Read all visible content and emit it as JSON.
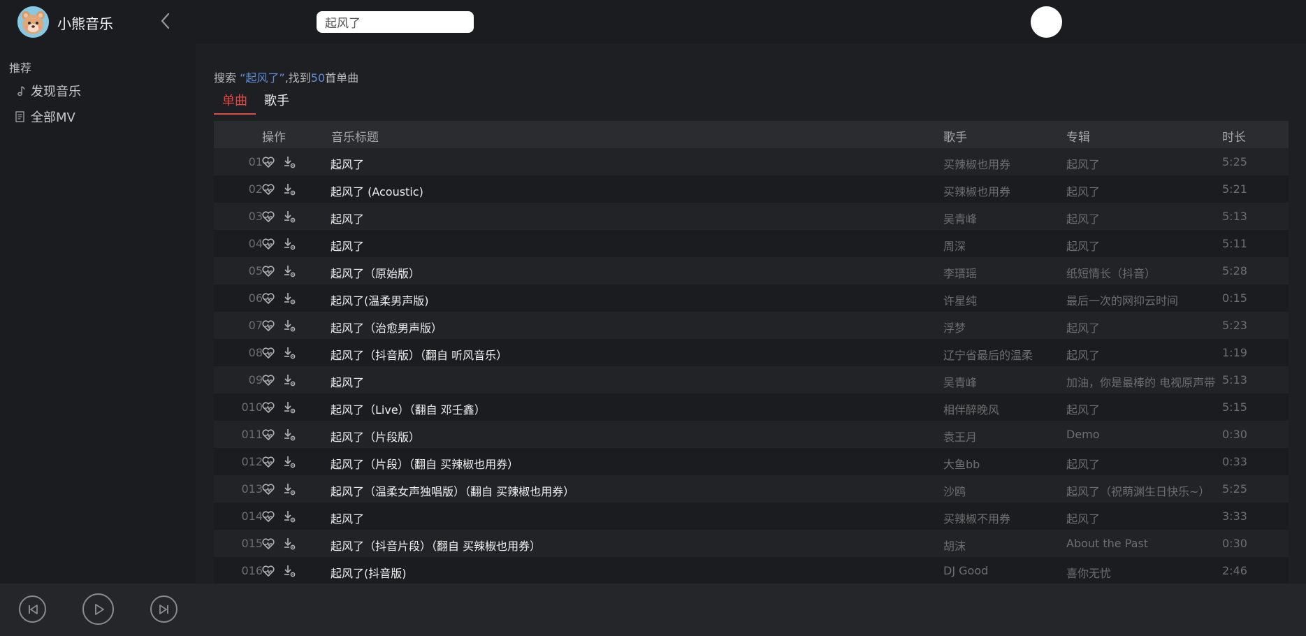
{
  "header": {
    "app_name": "小熊音乐",
    "search_value": "起风了"
  },
  "sidebar": {
    "heading": "推荐",
    "items": [
      {
        "label": "发现音乐",
        "icon": "music-note-icon"
      },
      {
        "label": "全部MV",
        "icon": "document-icon"
      }
    ]
  },
  "search_summary": {
    "prefix": "搜索",
    "query": "“起风了”",
    "middle": ",找到",
    "count": "50",
    "suffix": "首单曲"
  },
  "tabs": [
    {
      "label": "单曲",
      "active": true
    },
    {
      "label": "歌手",
      "active": false
    }
  ],
  "table": {
    "headers": {
      "ops": "操作",
      "title": "音乐标题",
      "artist": "歌手",
      "album": "专辑",
      "duration": "时长"
    },
    "rows": [
      {
        "idx": "01",
        "title": "起风了",
        "artist": "买辣椒也用券",
        "album": "起风了",
        "duration": "5:25"
      },
      {
        "idx": "02",
        "title": "起风了 (Acoustic)",
        "artist": "买辣椒也用券",
        "album": "起风了",
        "duration": "5:21"
      },
      {
        "idx": "03",
        "title": "起风了",
        "artist": "吴青峰",
        "album": "起风了",
        "duration": "5:13"
      },
      {
        "idx": "04",
        "title": "起风了",
        "artist": "周深",
        "album": "起风了",
        "duration": "5:11"
      },
      {
        "idx": "05",
        "title": "起风了（原始版）",
        "artist": "李瑨瑶",
        "album": "纸短情长（抖音）",
        "duration": "5:28"
      },
      {
        "idx": "06",
        "title": "起风了(温柔男声版)",
        "artist": "许星纯",
        "album": "最后一次的网抑云时间",
        "duration": "0:15"
      },
      {
        "idx": "07",
        "title": "起风了（治愈男声版）",
        "artist": "浮梦",
        "album": "起风了",
        "duration": "5:23"
      },
      {
        "idx": "08",
        "title": "起风了（抖音版）（翻自 听风音乐）",
        "artist": "辽宁省最后的温柔",
        "album": "起风了",
        "duration": "1:19"
      },
      {
        "idx": "09",
        "title": "起风了",
        "artist": "吴青峰",
        "album": "加油，你是最棒的 电视原声带",
        "duration": "5:13"
      },
      {
        "idx": "010",
        "title": "起风了（Live）（翻自 邓壬鑫）",
        "artist": "相伴醉晚风",
        "album": "起风了",
        "duration": "5:15"
      },
      {
        "idx": "011",
        "title": "起风了（片段版）",
        "artist": "袁王月",
        "album": "Demo",
        "duration": "0:30"
      },
      {
        "idx": "012",
        "title": "起风了（片段）（翻自 买辣椒也用券）",
        "artist": "大鱼bb",
        "album": "起风了",
        "duration": "0:33"
      },
      {
        "idx": "013",
        "title": "起风了（温柔女声独唱版）（翻自 买辣椒也用券）",
        "artist": "沙鸥",
        "album": "起风了（祝萌渊生日快乐~）",
        "duration": "5:25"
      },
      {
        "idx": "014",
        "title": "起风了",
        "artist": "买辣椒不用券",
        "album": "起风了",
        "duration": "3:33"
      },
      {
        "idx": "015",
        "title": "起风了（抖音片段）（翻自 买辣椒也用券）",
        "artist": "胡沫",
        "album": "About the Past",
        "duration": "0:30"
      },
      {
        "idx": "016",
        "title": "起风了(抖音版)",
        "artist": "DJ Good",
        "album": "喜你无忧",
        "duration": "2:46"
      }
    ]
  },
  "player": {
    "buttons": [
      "previous-icon",
      "play-icon",
      "next-icon"
    ]
  },
  "colors": {
    "accent": "#e04a4a",
    "highlight": "#5e8fd8",
    "background": "#1e1f23"
  }
}
